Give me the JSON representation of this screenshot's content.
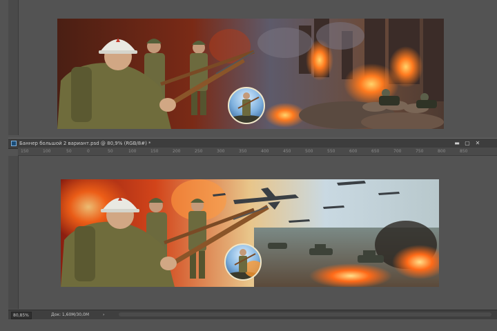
{
  "window": {
    "title": "Баннер большой 2 вариант.psd @ 80,9% (RGB/8#) *",
    "controls": {
      "minimize": "▬",
      "maximize": "▢",
      "close": "✕"
    }
  },
  "ruler": {
    "ticks": [
      "150",
      "100",
      "50",
      "0",
      "50",
      "100",
      "150",
      "200",
      "250",
      "300",
      "350",
      "400",
      "450",
      "500",
      "550",
      "600",
      "650",
      "700",
      "750",
      "800",
      "850"
    ]
  },
  "status": {
    "zoom": "80,85%",
    "doc_info": "Док: 1,60M/30,0M",
    "arrow": "›"
  },
  "colors": {
    "workspace": "#535353",
    "titlebar": "#3d3d3d",
    "ruler": "#4a4a4a",
    "statusbar": "#3f3f3f"
  }
}
